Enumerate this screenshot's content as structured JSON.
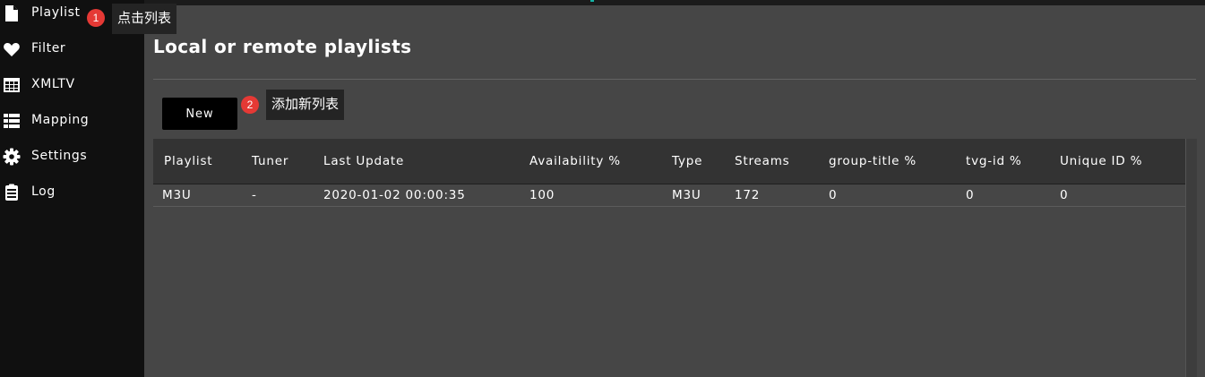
{
  "sidebar": {
    "items": [
      {
        "label": "Playlist",
        "icon": "file-icon"
      },
      {
        "label": "Filter",
        "icon": "heart-icon"
      },
      {
        "label": "XMLTV",
        "icon": "table-icon"
      },
      {
        "label": "Mapping",
        "icon": "list-icon"
      },
      {
        "label": "Settings",
        "icon": "gear-icon"
      },
      {
        "label": "Log",
        "icon": "clipboard-icon"
      }
    ]
  },
  "annotations": [
    {
      "number": "1",
      "text": "点击列表"
    },
    {
      "number": "2",
      "text": "添加新列表"
    }
  ],
  "main": {
    "title": "Local or remote playlists",
    "new_button": "New"
  },
  "table": {
    "columns": [
      "Playlist",
      "Tuner",
      "Last Update",
      "Availability %",
      "Type",
      "Streams",
      "group-title %",
      "tvg-id %",
      "Unique ID %"
    ],
    "rows": [
      [
        "M3U",
        "-",
        "2020-01-02 00:00:35",
        "100",
        "M3U",
        "172",
        "0",
        "0",
        "0"
      ]
    ]
  },
  "colors": {
    "background": "#464646",
    "sidebar": "#101010",
    "table_header": "#333333",
    "badge": "#e53935",
    "accent": "#14b3a6"
  }
}
